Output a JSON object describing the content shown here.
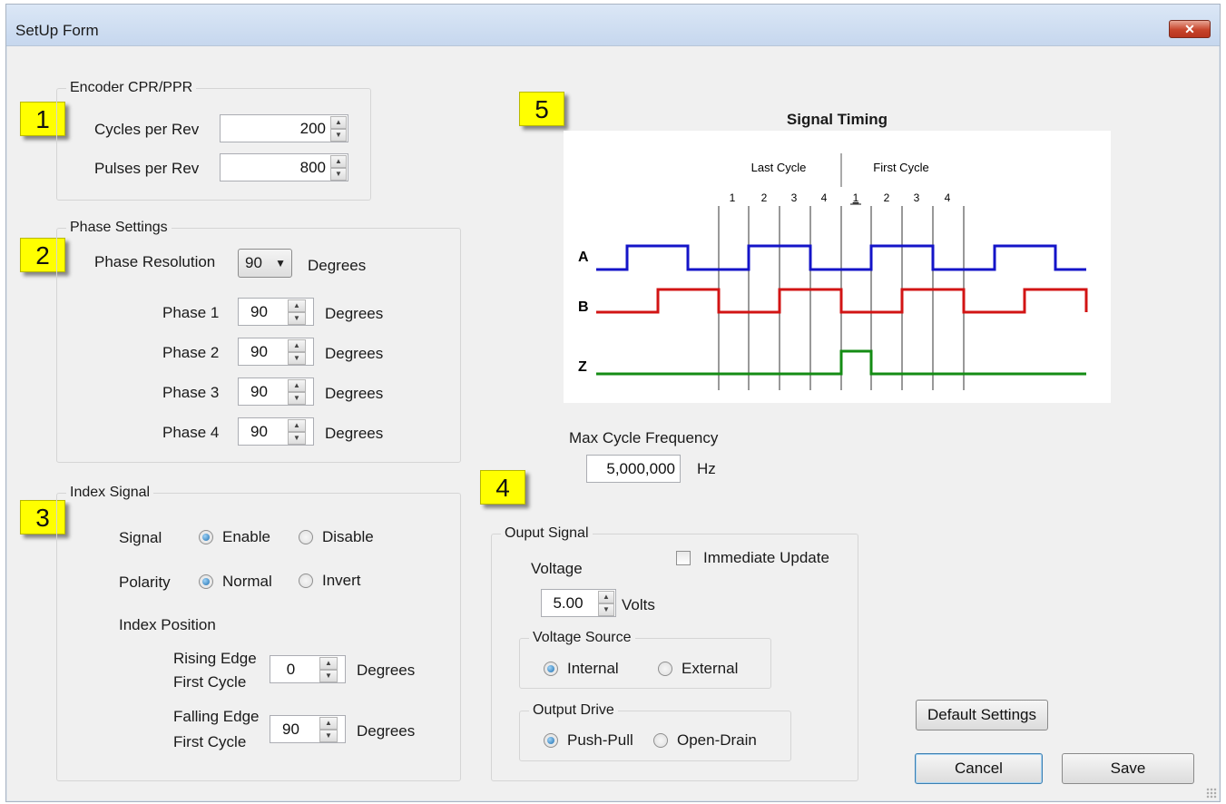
{
  "window": {
    "title": "SetUp Form",
    "close_label": "✕"
  },
  "callouts": [
    "1",
    "2",
    "3",
    "4",
    "5"
  ],
  "encoder": {
    "group_title": "Encoder CPR/PPR",
    "cycles_label": "Cycles per Rev",
    "cycles_value": "200",
    "pulses_label": "Pulses per Rev",
    "pulses_value": "800"
  },
  "phase": {
    "group_title": "Phase Settings",
    "resolution_label": "Phase Resolution",
    "resolution_value": "90",
    "degrees": "Degrees",
    "rows": [
      {
        "label": "Phase 1",
        "value": "90"
      },
      {
        "label": "Phase 2",
        "value": "90"
      },
      {
        "label": "Phase 3",
        "value": "90"
      },
      {
        "label": "Phase 4",
        "value": "90"
      }
    ]
  },
  "index": {
    "group_title": "Index Signal",
    "signal_label": "Signal",
    "enable": "Enable",
    "disable": "Disable",
    "polarity_label": "Polarity",
    "normal": "Normal",
    "invert": "Invert",
    "position_label": "Index Position",
    "rising_l1": "Rising Edge",
    "rising_l2": "First Cycle",
    "rising_value": "0",
    "falling_l1": "Falling Edge",
    "falling_l2": "First Cycle",
    "falling_value": "90",
    "degrees": "Degrees"
  },
  "timing": {
    "title": "Signal Timing",
    "last_cycle": "Last Cycle",
    "first_cycle": "First Cycle",
    "ticks_last": [
      "1",
      "2",
      "3",
      "4"
    ],
    "ticks_first": [
      "1",
      "2",
      "3",
      "4"
    ],
    "channels": [
      "A",
      "B",
      "Z"
    ],
    "colors": {
      "A": "#1414c8",
      "B": "#d21414",
      "Z": "#148c14"
    }
  },
  "frequency": {
    "label": "Max Cycle Frequency",
    "value": "5,000,000",
    "unit": "Hz"
  },
  "output": {
    "group_title": "Ouput Signal",
    "voltage_label": "Voltage",
    "voltage_value": "5.00",
    "volts": "Volts",
    "immediate_update": "Immediate Update",
    "source_title": "Voltage Source",
    "internal": "Internal",
    "external": "External",
    "drive_title": "Output Drive",
    "push_pull": "Push-Pull",
    "open_drain": "Open-Drain"
  },
  "buttons": {
    "default_settings": "Default Settings",
    "cancel": "Cancel",
    "save": "Save"
  }
}
